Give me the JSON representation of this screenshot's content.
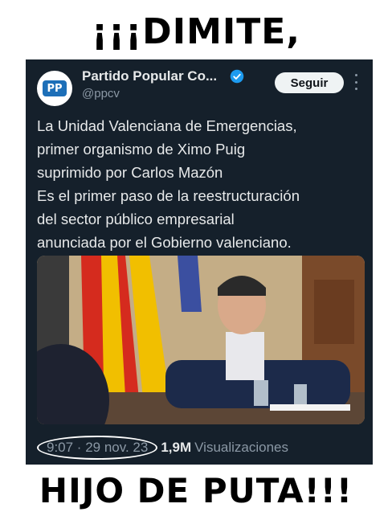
{
  "captions": {
    "top": "¡¡¡DIMITE,",
    "bottom": "HIJO DE PUTA!!!"
  },
  "tweet": {
    "account_name": "Partido Popular Co...",
    "handle": "@ppcv",
    "follow_label": "Seguir",
    "avatar_logo_text": "PP",
    "text": "La Unidad Valenciana de Emergencias,\nprimer organismo de Ximo Puig\nsuprimido por Carlos Mazón\nEs el primer paso de la reestructuración\ndel sector público empresarial\nanunciada por el Gobierno valenciano.",
    "timestamp": "9:07 · 29 nov. 23",
    "separator": "·",
    "views_count": "1,9M",
    "views_label": "Visualizaciones"
  },
  "icons": {
    "verified": "verified-badge-icon",
    "more": "more-options-icon"
  },
  "colors": {
    "tweet_background": "#15202b",
    "verified_blue": "#1d9bf0",
    "muted_text": "#8b98a5"
  }
}
